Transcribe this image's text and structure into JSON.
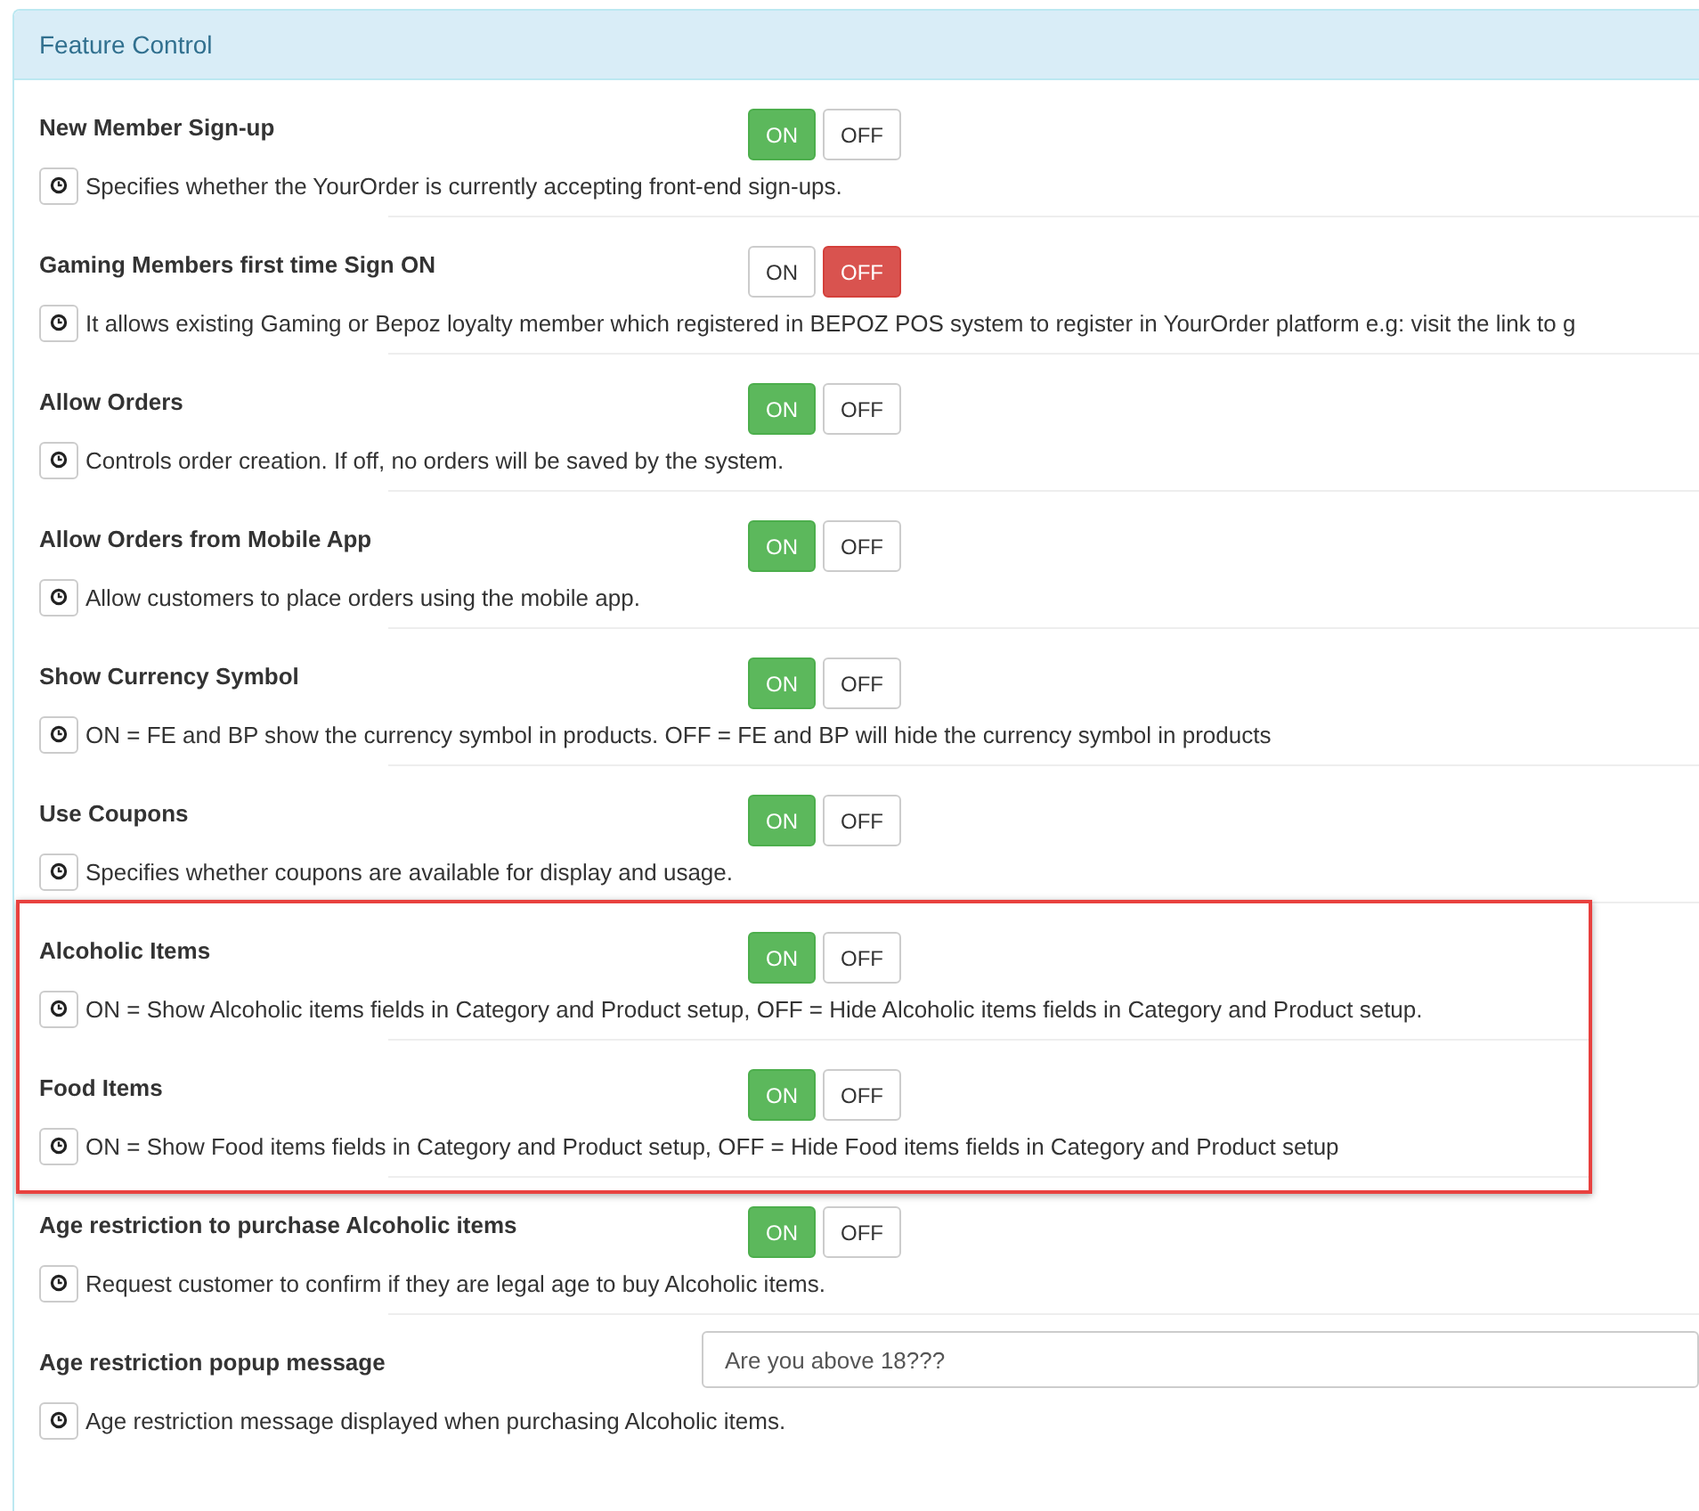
{
  "panel": {
    "title": "Feature Control"
  },
  "rows": [
    {
      "kind": "toggle",
      "label": "New Member Sign-up",
      "on_label": "ON",
      "off_label": "OFF",
      "on": true,
      "highlighted": false,
      "description": "Specifies whether the YourOrder is currently accepting front-end sign-ups."
    },
    {
      "kind": "toggle",
      "label": "Gaming Members first time Sign ON",
      "on_label": "ON",
      "off_label": "OFF",
      "on": false,
      "highlighted": false,
      "description": "It allows existing Gaming or Bepoz loyalty member which registered in BEPOZ POS system to register in YourOrder platform e.g: visit the link to g"
    },
    {
      "kind": "toggle",
      "label": "Allow Orders",
      "on_label": "ON",
      "off_label": "OFF",
      "on": true,
      "highlighted": false,
      "description": "Controls order creation. If off, no orders will be saved by the system."
    },
    {
      "kind": "toggle",
      "label": "Allow Orders from Mobile App",
      "on_label": "ON",
      "off_label": "OFF",
      "on": true,
      "highlighted": false,
      "description": "Allow customers to place orders using the mobile app."
    },
    {
      "kind": "toggle",
      "label": "Show Currency Symbol",
      "on_label": "ON",
      "off_label": "OFF",
      "on": true,
      "highlighted": false,
      "description": "ON = FE and BP show the currency symbol in products. OFF = FE and BP will hide the currency symbol in products"
    },
    {
      "kind": "toggle",
      "label": "Use Coupons",
      "on_label": "ON",
      "off_label": "OFF",
      "on": true,
      "highlighted": false,
      "description": "Specifies whether coupons are available for display and usage."
    },
    {
      "kind": "toggle",
      "label": "Alcoholic Items",
      "on_label": "ON",
      "off_label": "OFF",
      "on": true,
      "highlighted": true,
      "description": "ON = Show Alcoholic items fields in Category and Product setup, OFF = Hide Alcoholic items fields in Category and Product setup."
    },
    {
      "kind": "toggle",
      "label": "Food Items",
      "on_label": "ON",
      "off_label": "OFF",
      "on": true,
      "highlighted": true,
      "description": "ON = Show Food items fields in Category and Product setup, OFF = Hide Food items fields in Category and Product setup"
    },
    {
      "kind": "toggle",
      "label": "Age restriction to purchase Alcoholic items",
      "on_label": "ON",
      "off_label": "OFF",
      "on": true,
      "highlighted": false,
      "description": "Request customer to confirm if they are legal age to buy Alcoholic items."
    },
    {
      "kind": "text",
      "label": "Age restriction popup message",
      "value": "Are you above 18???",
      "highlighted": false,
      "description": "Age restriction message displayed when purchasing Alcoholic items."
    }
  ]
}
